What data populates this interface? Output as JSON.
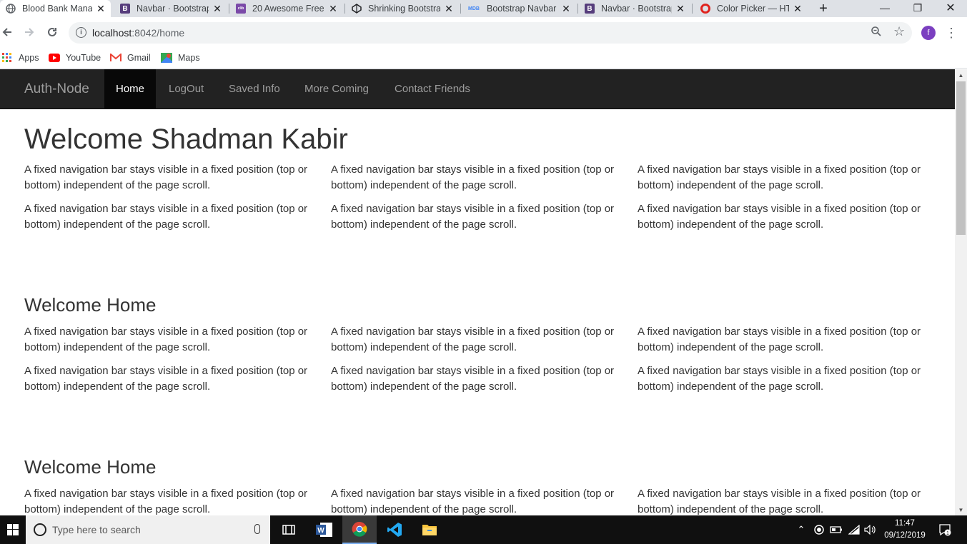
{
  "browser": {
    "tabs": [
      {
        "title": "Blood Bank Manag",
        "favicon": "globe-icon",
        "active": true
      },
      {
        "title": "Navbar · Bootstrap",
        "favicon": "bootstrap-icon"
      },
      {
        "title": "20 Awesome Free",
        "favicon": "colorlib-icon"
      },
      {
        "title": "Shrinking Bootstra",
        "favicon": "codepen-icon"
      },
      {
        "title": "Bootstrap Navbar",
        "favicon": "mdb-icon"
      },
      {
        "title": "Navbar · Bootstrap",
        "favicon": "bootstrap-icon"
      },
      {
        "title": "Color Picker — HT",
        "favicon": "opera-icon"
      }
    ],
    "url_host": "localhost",
    "url_rest": ":8042/home",
    "profile_initial": "f",
    "bookmarks": [
      {
        "label": "Apps",
        "icon": "apps-grid-icon"
      },
      {
        "label": "YouTube",
        "icon": "youtube-icon"
      },
      {
        "label": "Gmail",
        "icon": "gmail-icon"
      },
      {
        "label": "Maps",
        "icon": "maps-icon"
      }
    ]
  },
  "page": {
    "brand": "Auth-Node",
    "nav": [
      "Home",
      "LogOut",
      "Saved Info",
      "More Coming",
      "Contact Friends"
    ],
    "active_nav": "Home",
    "heading": "Welcome Shadman Kabir",
    "section_heading": "Welcome Home",
    "paragraph": "A fixed navigation bar stays visible in a fixed position (top or bottom) independent of the page scroll."
  },
  "taskbar": {
    "search_placeholder": "Type here to search",
    "time": "11:47",
    "date": "09/12/2019",
    "notification_count": "1"
  },
  "colors": {
    "navbar_bg": "#222222",
    "navbar_active": "#080808",
    "tab_strip": "#dee1e6"
  }
}
